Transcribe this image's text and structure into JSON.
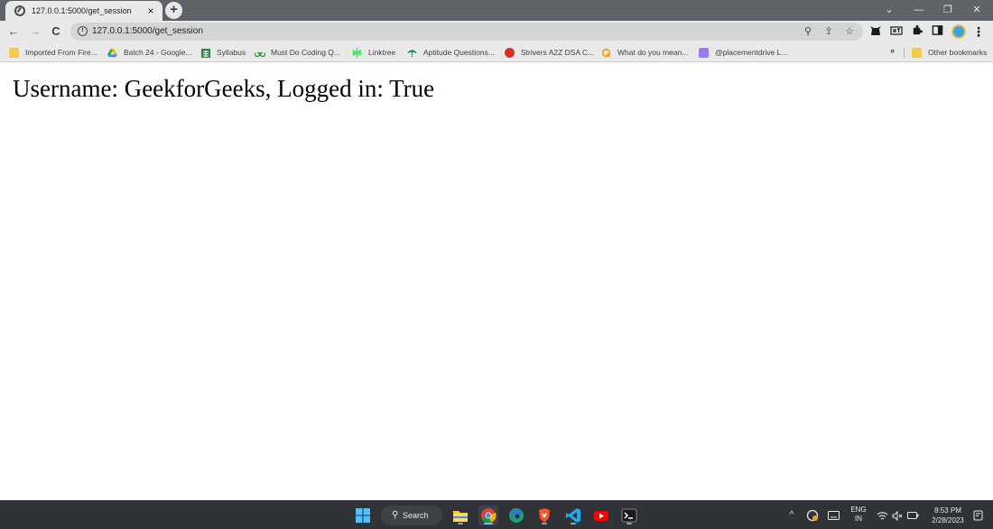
{
  "tab": {
    "title": "127.0.0.1:5000/get_session",
    "favicon": "globe-icon",
    "close_glyph": "×",
    "new_tab_glyph": "+"
  },
  "window_controls": {
    "dropdown": "⌄",
    "minimize": "—",
    "restore": "❐",
    "close": "✕"
  },
  "toolbar": {
    "back": "←",
    "forward": "→",
    "reload": "C",
    "url": "127.0.0.1:5000/get_session",
    "site_info": "i",
    "zoom": "⚲",
    "share": "⇪",
    "star": "☆",
    "menu": "⋮"
  },
  "bookmarks": [
    {
      "label": "Imported From Fire...",
      "icon": "folder-icon",
      "color": "#f5c84c"
    },
    {
      "label": "Batch 24 - Google...",
      "icon": "drive-icon",
      "color": "#1fa463"
    },
    {
      "label": "Syllabus",
      "icon": "sheet-icon",
      "color": "#3a7d44"
    },
    {
      "label": "Must Do Coding Q...",
      "icon": "gfg-icon",
      "color": "#2f8d46"
    },
    {
      "label": "Linktree",
      "icon": "linktree-icon",
      "color": "#43e660"
    },
    {
      "label": "Aptitude Questions...",
      "icon": "indiabix-icon",
      "color": "#2e8b57"
    },
    {
      "label": "Strivers A2Z DSA C...",
      "icon": "tuf-icon",
      "color": "#d93025"
    },
    {
      "label": "What do you mean...",
      "icon": "quora-icon",
      "color": "#f2a60c"
    },
    {
      "label": "@placementdrive L...",
      "icon": "telegram-icon",
      "color": "#9b7cf0"
    }
  ],
  "bookmarks_more": "»",
  "other_bookmarks": "Other bookmarks",
  "page": {
    "session_text": "Username: GeekforGeeks, Logged in: True"
  },
  "taskbar": {
    "search_label": "Search",
    "language_top": "ENG",
    "language_bottom": "IN",
    "time": "8:53 PM",
    "date": "2/28/2023"
  }
}
